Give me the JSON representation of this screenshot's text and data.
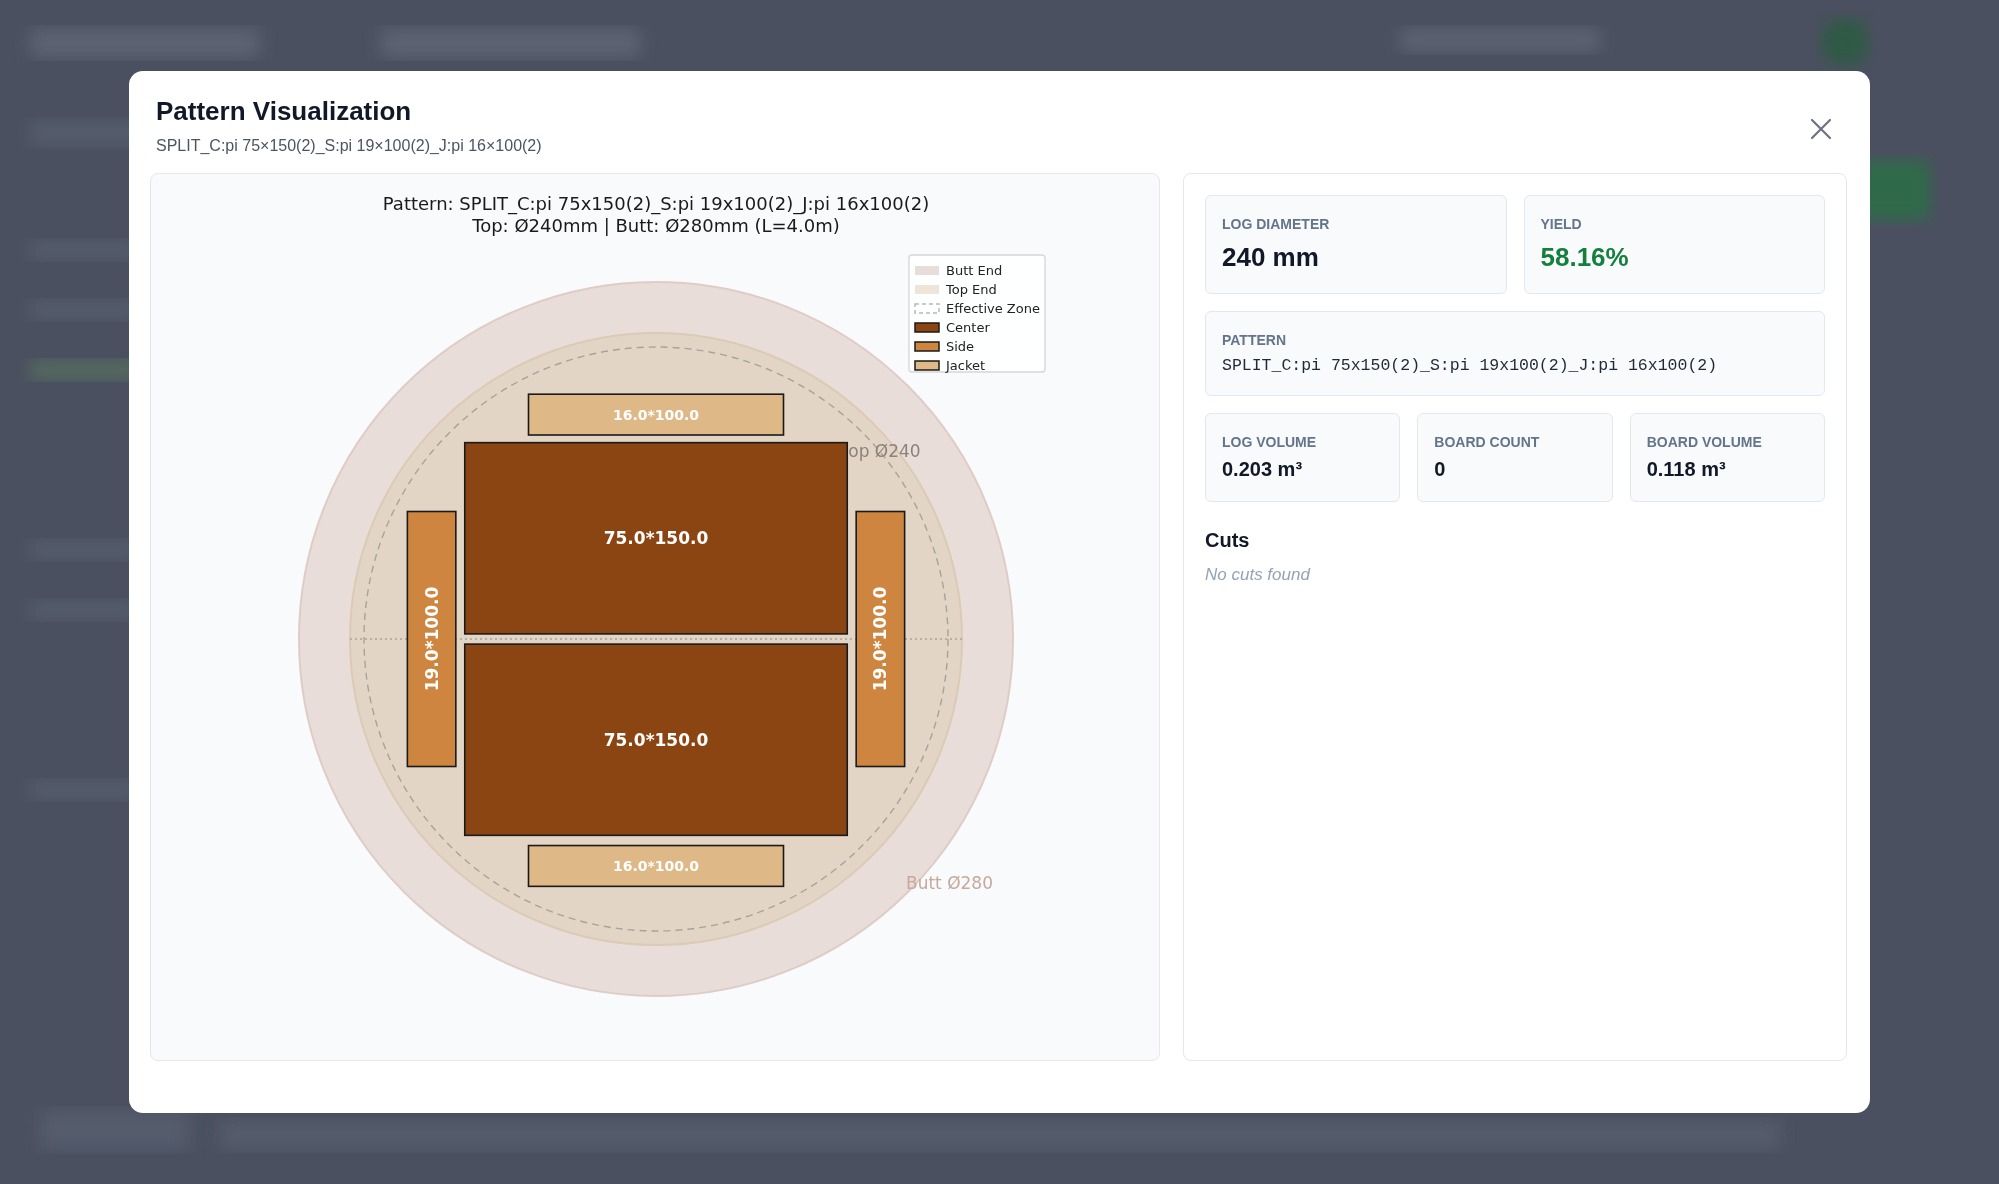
{
  "dialog": {
    "title": "Pattern Visualization",
    "subtitle": "SPLIT_C:pi 75×150(2)_S:pi 19×100(2)_J:pi 16×100(2)"
  },
  "visualization": {
    "title_lines": [
      "Pattern: SPLIT_C:pi 75x150(2)_S:pi 19x100(2)_J:pi 16x100(2)",
      "Top: Ø240mm | Butt: Ø280mm (L=4.0m)"
    ],
    "legend": [
      {
        "kind": "butt",
        "label": "Butt End"
      },
      {
        "kind": "top",
        "label": "Top End"
      },
      {
        "kind": "effective",
        "label": "Effective Zone"
      },
      {
        "kind": "center",
        "label": "Center"
      },
      {
        "kind": "side",
        "label": "Side"
      },
      {
        "kind": "jacket",
        "label": "Jacket"
      }
    ],
    "diameter_labels": [
      {
        "kind": "top",
        "text": "op Ø240"
      },
      {
        "kind": "butt",
        "text": "Butt Ø280"
      }
    ],
    "boards": [
      {
        "kind": "jacket",
        "label": "16.0*100.0"
      },
      {
        "kind": "center",
        "label": "75.0*150.0"
      },
      {
        "kind": "side",
        "label": "19.0*100.0"
      },
      {
        "kind": "side",
        "label": "19.0*100.0"
      },
      {
        "kind": "center",
        "label": "75.0*150.0"
      },
      {
        "kind": "jacket",
        "label": "16.0*100.0"
      }
    ]
  },
  "summary": {
    "rows": [
      [
        {
          "label": "LOG DIAMETER",
          "value": "240 mm",
          "kind": "large"
        },
        {
          "label": "YIELD",
          "value": "58.16%",
          "kind": "positive"
        }
      ],
      [
        {
          "label": "PATTERN",
          "value": "SPLIT_C:pi 75x150(2)_S:pi 19x100(2)_J:pi 16x100(2)",
          "kind": "code"
        }
      ],
      [
        {
          "label": "LOG VOLUME",
          "value": "0.203 m³",
          "kind": "number"
        },
        {
          "label": "BOARD COUNT",
          "value": "0",
          "kind": "number"
        },
        {
          "label": "BOARD VOLUME",
          "value": "0.118 m³",
          "kind": "number"
        }
      ]
    ],
    "cuts": {
      "title": "Cuts",
      "empty_text": "No cuts found"
    }
  }
}
